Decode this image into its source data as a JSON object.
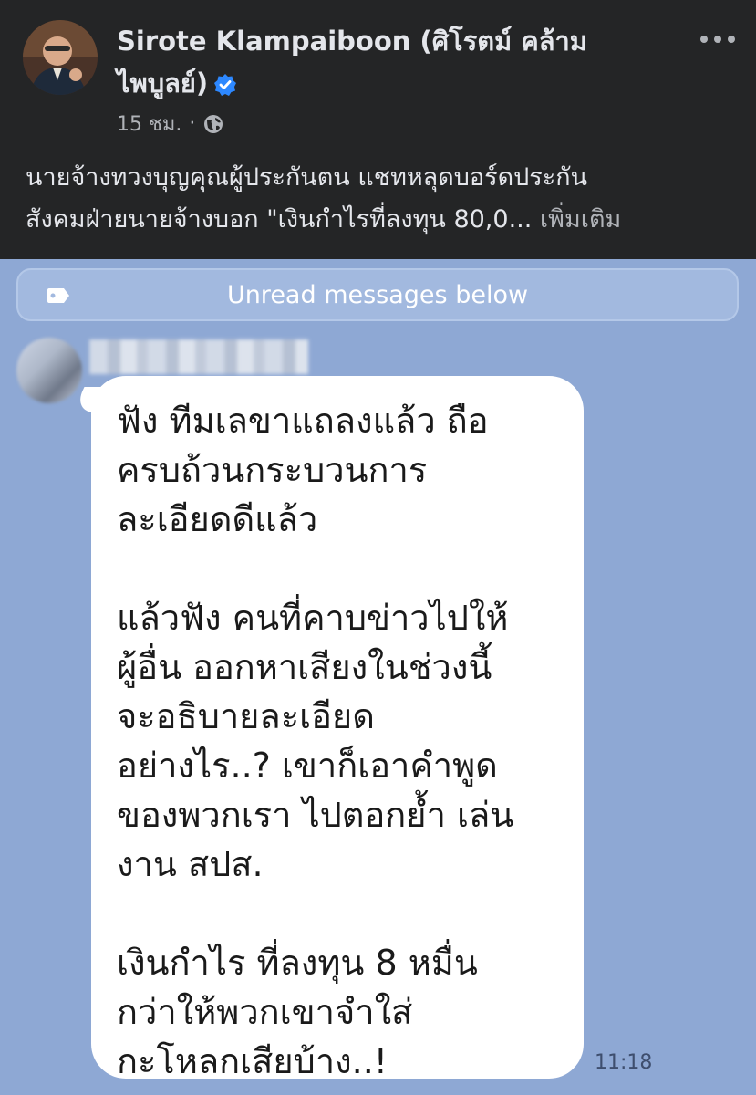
{
  "post": {
    "author": "Sirote Klampaiboon (ศิโรตม์ คล้าม\nไพบูลย์)",
    "time": "15 ชม.",
    "separator": "·",
    "more_icon": "more-horizontal-icon",
    "privacy_icon": "globe-icon",
    "verified_icon": "verified-badge-icon",
    "verified_color": "#2d88ff",
    "text": "นายจ้างทวงบุญคุณผู้ประกันตน แชทหลุดบอร์ดประกัน\nสังคมฝ่ายนายจ้างบอก \"เงินกำไรที่ลงทุน 80,0...",
    "see_more": "เพิ่มเติม"
  },
  "chat": {
    "background": "#8ea8d4",
    "unread_banner": "Unread messages below",
    "message": {
      "text": "ฟัง ทีมเลขาแถลงแล้ว ถือ\nครบถ้วนกระบวนการ\nละเอียดดีแล้ว\n\nแล้วฟัง คนที่คาบข่าวไปให้\nผู้อื่น ออกหาเสียงในช่วงนี้\nจะอธิบายละเอียด\nอย่างไร..? เขาก็เอาคำพูด\nของพวกเรา ไปตอกย้ำ เล่น\nงาน สปส.\n\nเงินกำไร ที่ลงทุน 8 หมื่น\nกว่าให้พวกเขาจำใส่\nกะโหลกเสียบ้าง..!",
      "time": "11:18"
    }
  }
}
